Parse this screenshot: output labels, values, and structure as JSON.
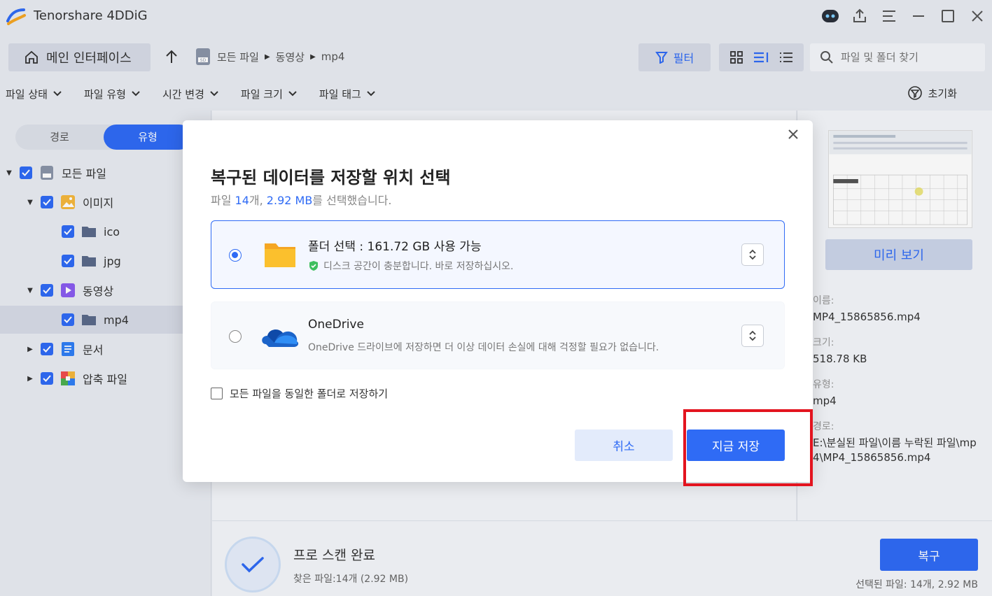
{
  "app": {
    "title": "Tenorshare 4DDiG"
  },
  "nav": {
    "home_label": "메인 인터페이스",
    "breadcrumb": [
      "모든 파일",
      "동영상",
      "mp4"
    ],
    "filter_label": "필터",
    "search_placeholder": "파일 및 폴더 찾기"
  },
  "filters": {
    "items": [
      "파일 상태",
      "파일 유형",
      "시간 변경",
      "파일 크기",
      "파일 태그"
    ],
    "reset_label": "초기화"
  },
  "sidebar": {
    "toggle": [
      "경로",
      "유형"
    ],
    "tree": [
      {
        "label": "모든 파일"
      },
      {
        "label": "이미지"
      },
      {
        "label": "ico"
      },
      {
        "label": "jpg"
      },
      {
        "label": "동영상"
      },
      {
        "label": "mp4"
      },
      {
        "label": "문서"
      },
      {
        "label": "압축 파일"
      }
    ]
  },
  "preview": {
    "button_label": "미리 보기",
    "name_label": "이름:",
    "name_value": "MP4_15865856.mp4",
    "size_label": "크기:",
    "size_value": "518.78 KB",
    "type_label": "유형:",
    "type_value": "mp4",
    "path_label": "경로:",
    "path_value": "E:\\분실된 파일\\이름 누락된 파일\\mp4\\MP4_15865856.mp4"
  },
  "bottom": {
    "scan_title": "프로 스캔 완료",
    "scan_sub": "찾은 파일:14개 (2.92 MB)",
    "recover_label": "복구",
    "selected_info": "선택된 파일: 14개, 2.92 MB"
  },
  "dialog": {
    "title": "복구된 데이터를 저장할 위치 선택",
    "sub_prefix": "파일 ",
    "sub_count": "14",
    "sub_mid": "개, ",
    "sub_size": "2.92 MB",
    "sub_suffix": "를 선택했습니다.",
    "option1_title": "폴더 선택 : 161.72 GB 사용 가능",
    "option1_desc": "디스크 공간이 충분합니다. 바로 저장하십시오.",
    "option2_title": "OneDrive",
    "option2_desc": "OneDrive 드라이브에 저장하면 더 이상 데이터 손실에 대해 걱정할 필요가 없습니다.",
    "same_folder_label": "모든 파일을 동일한 폴더로 저장하기",
    "cancel_label": "취소",
    "save_label": "지금 저장"
  },
  "colors": {
    "accent": "#2f6bf5",
    "highlight": "#e3141f"
  }
}
